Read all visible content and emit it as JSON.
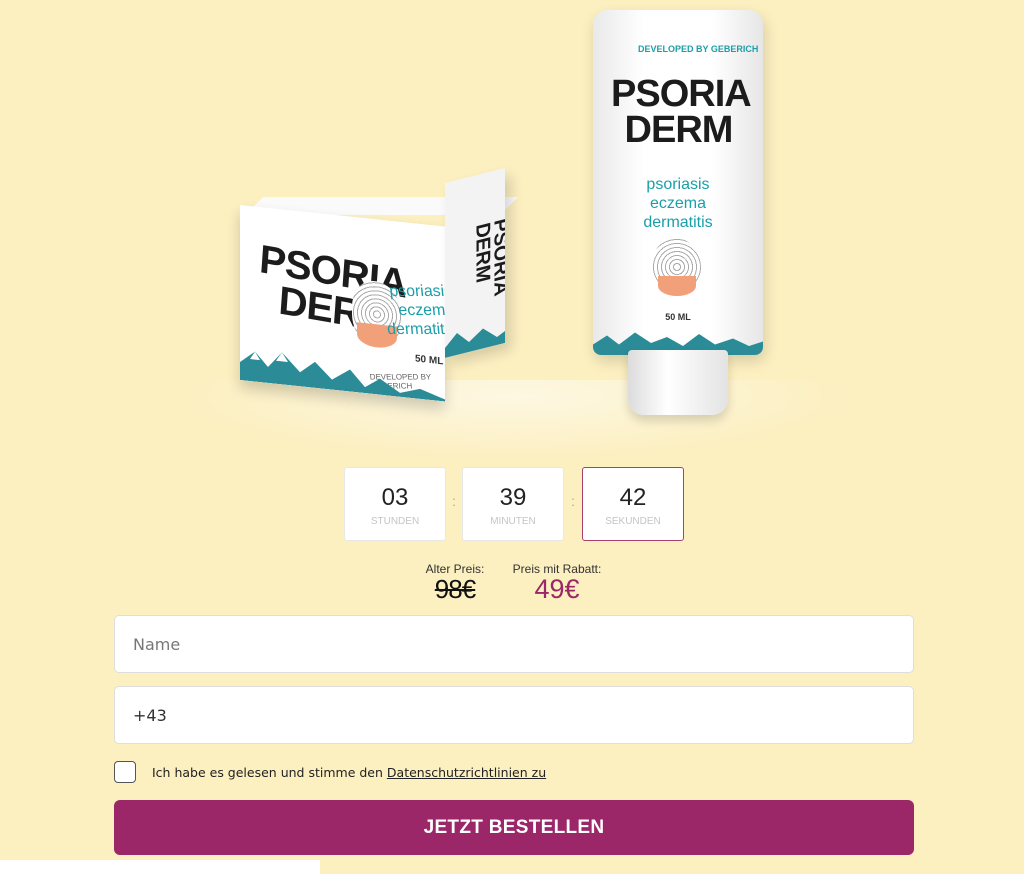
{
  "product": {
    "brand_line1": "PSORIA",
    "brand_line2": "DERM",
    "indications": [
      "psoriasis",
      "eczema",
      "dermatitis"
    ],
    "volume": "50 ML",
    "developer": "DEVELOPED BY GEBERICH"
  },
  "countdown": {
    "hours": "03",
    "hours_label": "STUNDEN",
    "minutes": "39",
    "minutes_label": "MINUTEN",
    "seconds": "42",
    "seconds_label": "SEKUNDEN",
    "separator": ":"
  },
  "pricing": {
    "old_label": "Alter Preis:",
    "old_price": "98€",
    "new_label": "Preis mit Rabatt:",
    "new_price": "49€"
  },
  "form": {
    "name_placeholder": "Name",
    "phone_value": "+43",
    "consent_text": "Ich habe es gelesen und stimme den",
    "consent_link": "Datenschutzrichtlinien zu",
    "submit_label": "JETZT BESTELLEN"
  },
  "colors": {
    "background": "#fcefc0",
    "accent": "#9b2668",
    "teal": "#1a9fa8"
  }
}
